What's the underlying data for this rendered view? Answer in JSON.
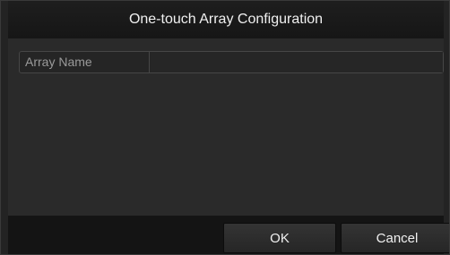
{
  "dialog": {
    "title": "One-touch Array Configuration"
  },
  "form": {
    "array_name_label": "Array Name",
    "array_name_value": ""
  },
  "buttons": {
    "ok_label": "OK",
    "cancel_label": "Cancel"
  }
}
